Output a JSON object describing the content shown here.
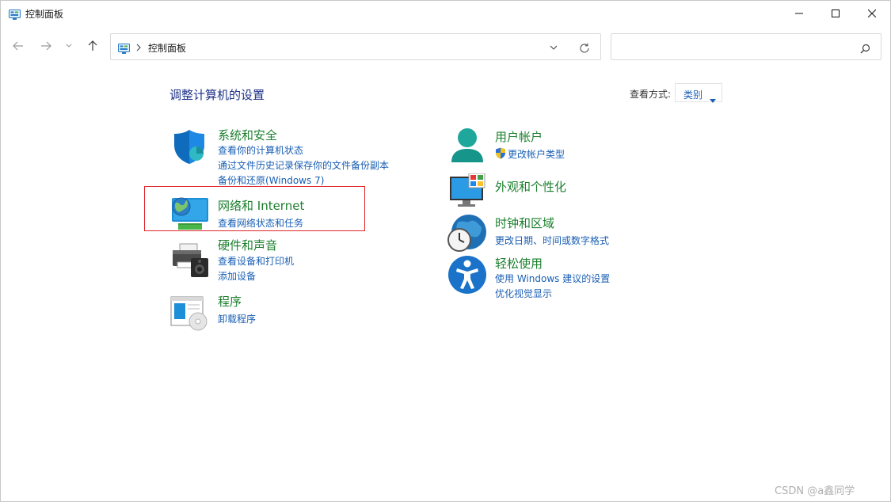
{
  "window": {
    "title": "控制面板",
    "title_icon": "control-panel-icon"
  },
  "address": {
    "path": "控制面板"
  },
  "search": {
    "placeholder": ""
  },
  "content": {
    "title": "调整计算机的设置",
    "viewby": {
      "label": "查看方式:",
      "value": "类别"
    }
  },
  "categories": [
    {
      "title": "系统和安全",
      "icon": "shield-icon",
      "links": [
        "查看你的计算机状态",
        "通过文件历史记录保存你的文件备份副本",
        "备份和还原(Windows 7)"
      ]
    },
    {
      "title": "网络和 Internet",
      "icon": "network-globe-icon",
      "links": [
        "查看网络状态和任务"
      ]
    },
    {
      "title": "硬件和声音",
      "icon": "printer-speaker-icon",
      "links": [
        "查看设备和打印机",
        "添加设备"
      ]
    },
    {
      "title": "程序",
      "icon": "programs-icon",
      "links": [
        "卸载程序"
      ]
    },
    {
      "title": "用户帐户",
      "icon": "user-icon",
      "links": [
        "更改帐户类型"
      ]
    },
    {
      "title": "外观和个性化",
      "icon": "monitor-palette-icon",
      "links": []
    },
    {
      "title": "时钟和区域",
      "icon": "clock-globe-icon",
      "links": [
        "更改日期、时间或数字格式"
      ]
    },
    {
      "title": "轻松使用",
      "icon": "accessibility-icon",
      "links": [
        "使用 Windows 建议的设置",
        "优化视觉显示"
      ]
    }
  ],
  "colors": {
    "title_blue": "#1e3287",
    "category_green": "#1b7f2d",
    "link_blue": "#1a5fb4",
    "highlight_red": "#e0262b"
  },
  "watermark": "CSDN @a鑫同学"
}
